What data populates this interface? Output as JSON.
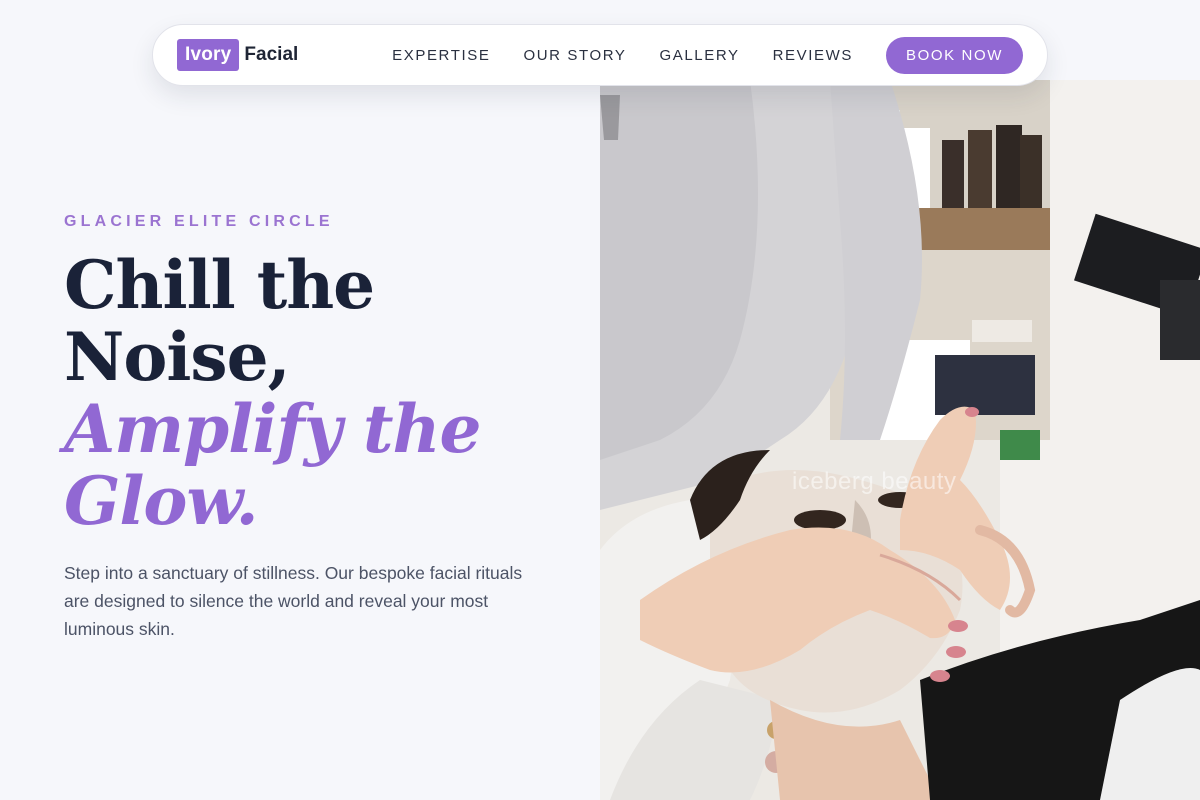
{
  "brand": {
    "box_text": "Ivory",
    "word_text": "Facial"
  },
  "nav": {
    "links": [
      "EXPERTISE",
      "OUR STORY",
      "GALLERY",
      "REVIEWS"
    ],
    "cta_label": "BOOK NOW"
  },
  "hero": {
    "eyebrow": "GLACIER ELITE CIRCLE",
    "headline_line1": "Chill the",
    "headline_line2": "Noise,",
    "headline_accent_line1": "Amplify the",
    "headline_accent_line2": "Glow.",
    "description": "Step into a sanctuary of stillness. Our bespoke facial rituals are designed to silence the world and reveal your most luminous skin."
  },
  "photo": {
    "watermark": "iceberg beauty"
  },
  "colors": {
    "accent": "#9168d3",
    "heading": "#1a2238",
    "page_background": "#f6f7fb"
  }
}
